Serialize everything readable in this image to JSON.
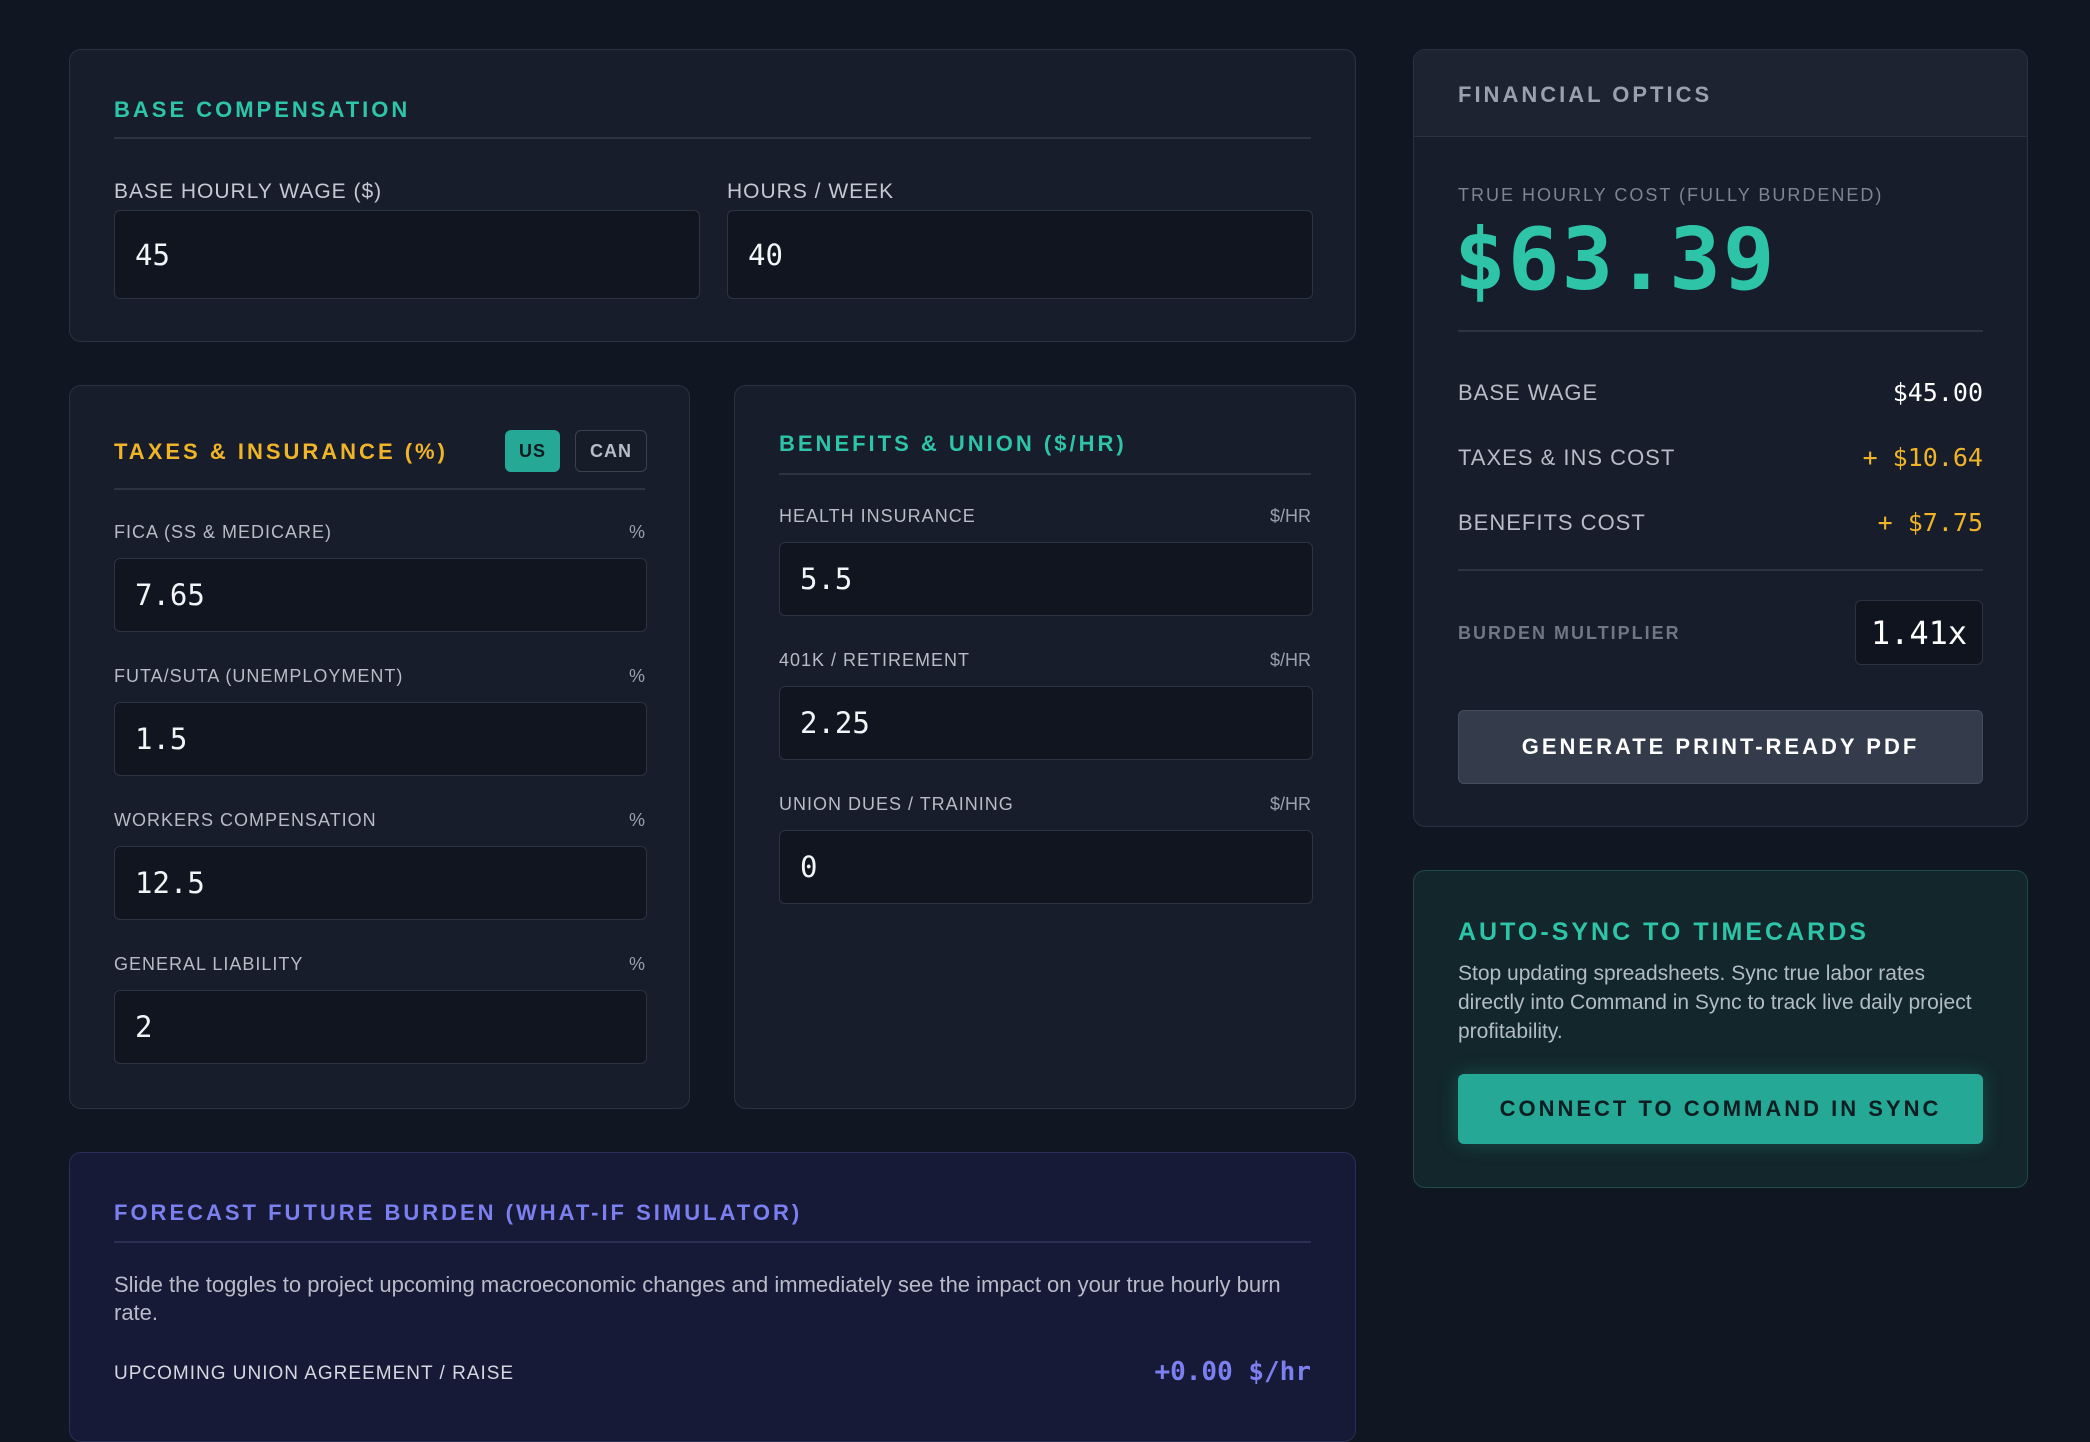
{
  "base_comp": {
    "title": "BASE COMPENSATION",
    "wage_label": "BASE HOURLY WAGE ($)",
    "wage_value": "45",
    "hours_label": "HOURS / WEEK",
    "hours_value": "40"
  },
  "taxes": {
    "title": "TAXES & INSURANCE (%)",
    "toggle_us": "US",
    "toggle_can": "CAN",
    "fields": [
      {
        "label": "FICA (SS & MEDICARE)",
        "unit": "%",
        "value": "7.65"
      },
      {
        "label": "FUTA/SUTA (UNEMPLOYMENT)",
        "unit": "%",
        "value": "1.5"
      },
      {
        "label": "WORKERS COMPENSATION",
        "unit": "%",
        "value": "12.5"
      },
      {
        "label": "GENERAL LIABILITY",
        "unit": "%",
        "value": "2"
      }
    ]
  },
  "benefits": {
    "title": "BENEFITS & UNION ($/HR)",
    "fields": [
      {
        "label": "HEALTH INSURANCE",
        "unit": "$/HR",
        "value": "5.5"
      },
      {
        "label": "401K / RETIREMENT",
        "unit": "$/HR",
        "value": "2.25"
      },
      {
        "label": "UNION DUES / TRAINING",
        "unit": "$/HR",
        "value": "0"
      }
    ]
  },
  "forecast": {
    "title": "FORECAST FUTURE BURDEN (WHAT-IF SIMULATOR)",
    "description": "Slide the toggles to project upcoming macroeconomic changes and immediately see the impact on your true hourly burn rate.",
    "raise_label": "UPCOMING UNION AGREEMENT / RAISE",
    "raise_value": "+0.00 $/hr"
  },
  "optics": {
    "header": "FINANCIAL OPTICS",
    "true_cost_label": "TRUE HOURLY COST (FULLY BURDENED)",
    "true_cost_value": "$63.39",
    "rows": [
      {
        "label": "BASE WAGE",
        "value": "$45.00"
      },
      {
        "label": "TAXES & INS COST",
        "value": "+ $10.64"
      },
      {
        "label": "BENEFITS COST",
        "value": "+ $7.75"
      }
    ],
    "multiplier_label": "BURDEN MULTIPLIER",
    "multiplier_value": "1.41x",
    "pdf_button": "GENERATE PRINT-READY PDF"
  },
  "sync": {
    "title": "AUTO-SYNC TO TIMECARDS",
    "description": "Stop updating spreadsheets. Sync true labor rates directly into Command in Sync to track live daily project profitability.",
    "button": "CONNECT TO COMMAND IN SYNC"
  },
  "colors": {
    "teal": "#2ec4a8",
    "amber": "#f0b429",
    "violet": "#7b7ff0",
    "background": "#111623"
  }
}
